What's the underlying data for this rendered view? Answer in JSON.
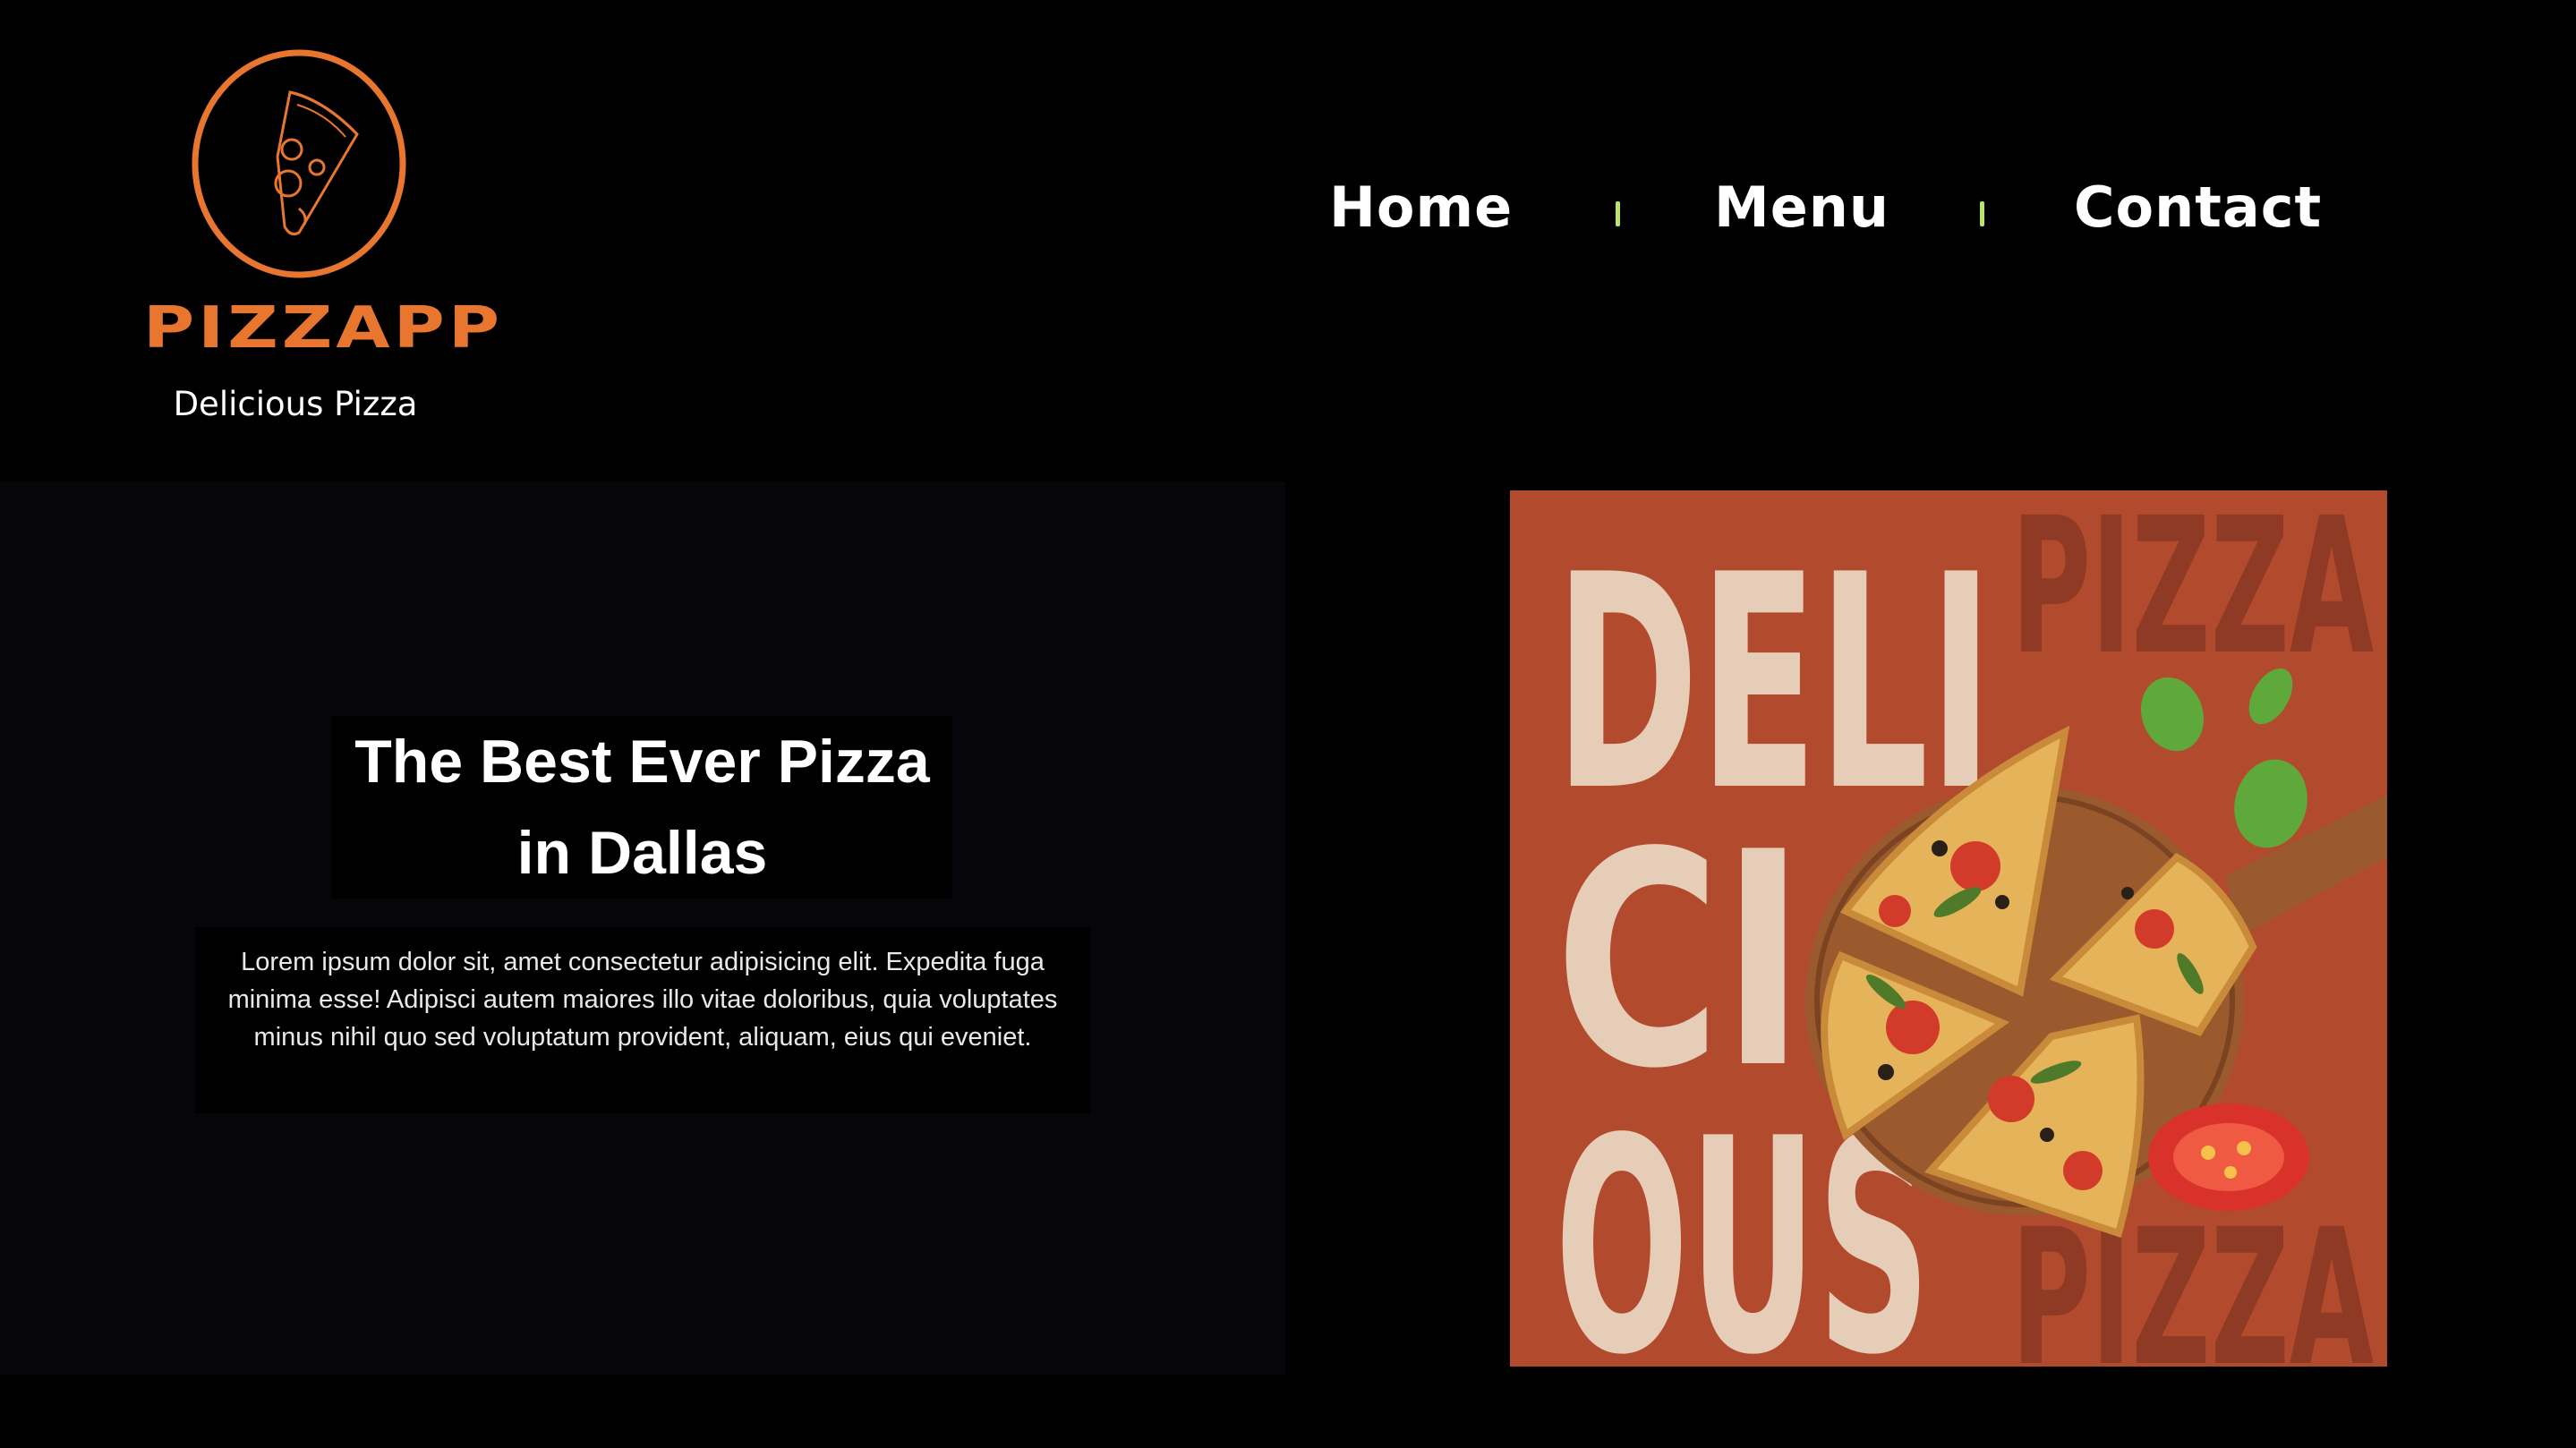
{
  "brand": {
    "name": "PIZZAPP",
    "tagline": "Delicious Pizza",
    "accent_color": "#e8762e"
  },
  "nav": {
    "items": [
      {
        "label": "Home"
      },
      {
        "label": "Menu"
      },
      {
        "label": "Contact"
      }
    ],
    "separator_color": "#b8e46a"
  },
  "hero": {
    "title_line1": "The Best Ever Pizza",
    "title_line2": "in Dallas",
    "description": "Lorem ipsum dolor sit, amet consectetur adipisicing elit. Expedita fuga minima esse! Adipisci autem maiores illo vitae doloribus, quia voluptates minus nihil quo sed voluptatum provident, aliquam, eius qui eveniet."
  },
  "poster": {
    "big_word_lines": [
      "DELI",
      "CI",
      "OUS"
    ],
    "bg_word": "PIZZA",
    "background_color": "#b24b2e",
    "text_color": "#e6cdb8"
  }
}
